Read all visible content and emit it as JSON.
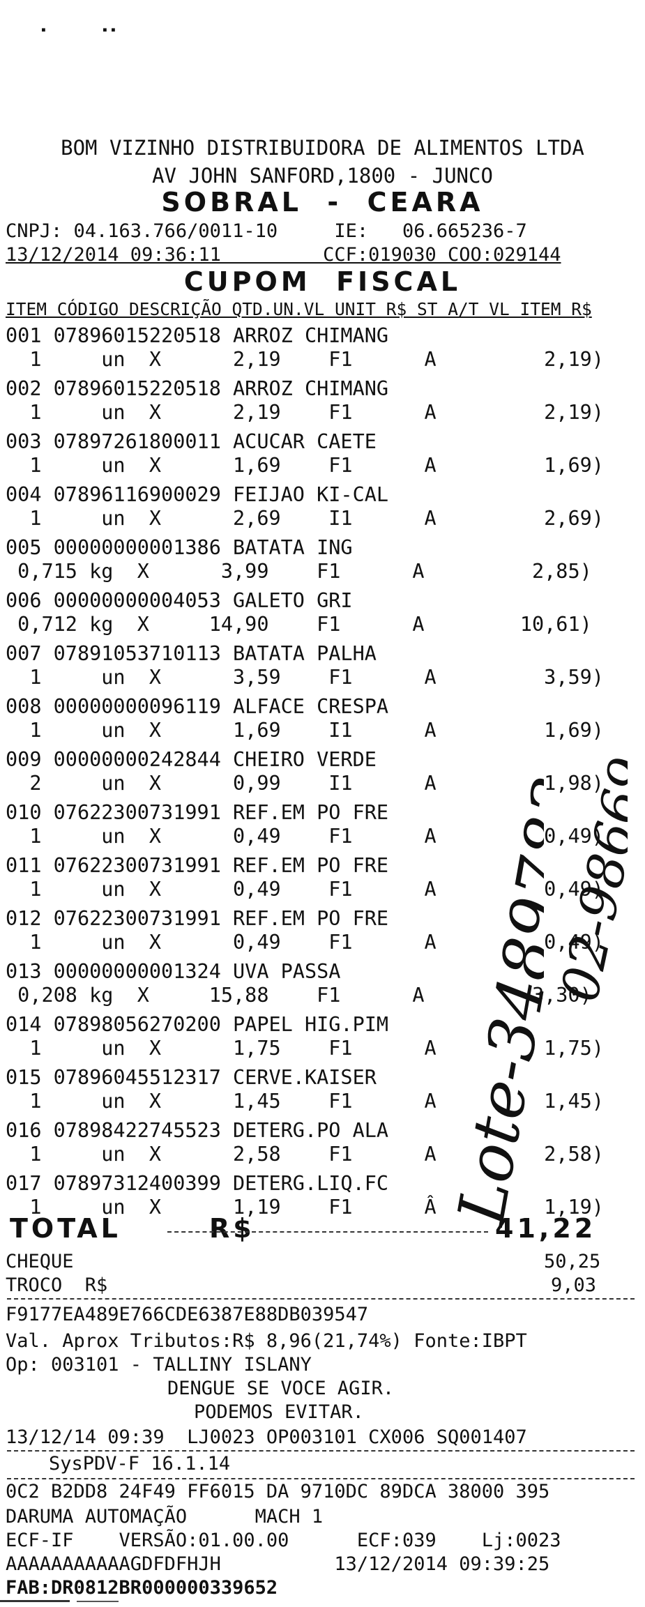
{
  "header": {
    "company": "BOM VIZINHO DISTRIBUIDORA DE ALIMENTOS LTDA",
    "address": "AV JOHN SANFORD,1800 - JUNCO",
    "city": "SOBRAL  -  CEARA",
    "cnpj_ie": "CNPJ: 04.163.766/0011-10     IE:   06.665236-7",
    "datetime_ccf_coo": "13/12/2014 09:36:11         CCF:019030 COO:029144",
    "title": "CUPOM  FISCAL",
    "columns": "ITEM CÓDIGO DESCRIÇÃO QTD.UN.VL UNIT R$ ST A/T VL ITEM R$"
  },
  "items": [
    {
      "line1": "001 07896015220518 ARROZ CHIMANG",
      "line2": "  1     un  X      2,19    F1      A         2,19)"
    },
    {
      "line1": "002 07896015220518 ARROZ CHIMANG",
      "line2": "  1     un  X      2,19    F1      A         2,19)"
    },
    {
      "line1": "003 07897261800011 ACUCAR CAETE",
      "line2": "  1     un  X      1,69    F1      A         1,69)"
    },
    {
      "line1": "004 07896116900029 FEIJAO KI-CAL",
      "line2": "  1     un  X      2,69    I1      A         2,69)"
    },
    {
      "line1": "005 00000000001386 BATATA ING",
      "line2": " 0,715 kg  X      3,99    F1      A         2,85)"
    },
    {
      "line1": "006 00000000004053 GALETO GRI",
      "line2": " 0,712 kg  X     14,90    F1      A        10,61)"
    },
    {
      "line1": "007 07891053710113 BATATA PALHA",
      "line2": "  1     un  X      3,59    F1      A         3,59)"
    },
    {
      "line1": "008 00000000096119 ALFACE CRESPA",
      "line2": "  1     un  X      1,69    I1      A         1,69)"
    },
    {
      "line1": "009 00000000242844 CHEIRO VERDE",
      "line2": "  2     un  X      0,99    I1      A         1,98)"
    },
    {
      "line1": "010 07622300731991 REF.EM PO FRE",
      "line2": "  1     un  X      0,49    F1      A         0,49)"
    },
    {
      "line1": "011 07622300731991 REF.EM PO FRE",
      "line2": "  1     un  X      0,49    F1      A         0,49)"
    },
    {
      "line1": "012 07622300731991 REF.EM PO FRE",
      "line2": "  1     un  X      0,49    F1      A         0,49)"
    },
    {
      "line1": "013 00000000001324 UVA PASSA",
      "line2": " 0,208 kg  X     15,88    F1      A         3,30)"
    },
    {
      "line1": "014 07898056270200 PAPEL HIG.PIM",
      "line2": "  1     un  X      1,75    F1      A         1,75)"
    },
    {
      "line1": "015 07896045512317 CERVE.KAISER",
      "line2": "  1     un  X      1,45    F1      A         1,45)"
    },
    {
      "line1": "016 07898422745523 DETERG.PO ALA",
      "line2": "  1     un  X      2,58    F1      A         2,58)"
    },
    {
      "line1": "017 07897312400399 DETERG.LIQ.FC",
      "line2": "  1     un  X      1,19    F1      Â         1,19)"
    }
  ],
  "totals": {
    "total_label": "TOTAL",
    "currency": "R$",
    "total_value": "41,22",
    "cheque_label": "CHEQUE",
    "cheque_value": "50,25",
    "troco_label": "TROCO  R$",
    "troco_value": "9,03"
  },
  "footer": {
    "hash": "F9177EA489E766CDE6387E88DB039547",
    "tributos": "Val. Aprox Tributos:R$ 8,96(21,74%) Fonte:IBPT",
    "operator": "Op: 003101 - TALLINY ISLANY",
    "msg1": "DENGUE SE VOCE AGIR.",
    "msg2": "PODEMOS EVITAR.",
    "store_line": "13/12/14 09:39  LJ0023 OP003101 CX006 SQ001407",
    "version": "SysPDV-F 16.1.14",
    "code": "0C2 B2DD8 24F49 FF6015 DA 9710DC 89DCA 38000 395",
    "daruma": "DARUMA AUTOMAÇÃO      MACH 1",
    "ecf": "ECF-IF    VERSÃO:01.00.00      ECF:039    Lj:0023",
    "serial": "AAAAAAAAAAAGDFDFHJH          13/12/2014 09:39:25",
    "fab": "FAB:DR0812BR000000339652"
  },
  "handwriting": {
    "text1": "Lote-3489783",
    "text2": "02-98669"
  }
}
